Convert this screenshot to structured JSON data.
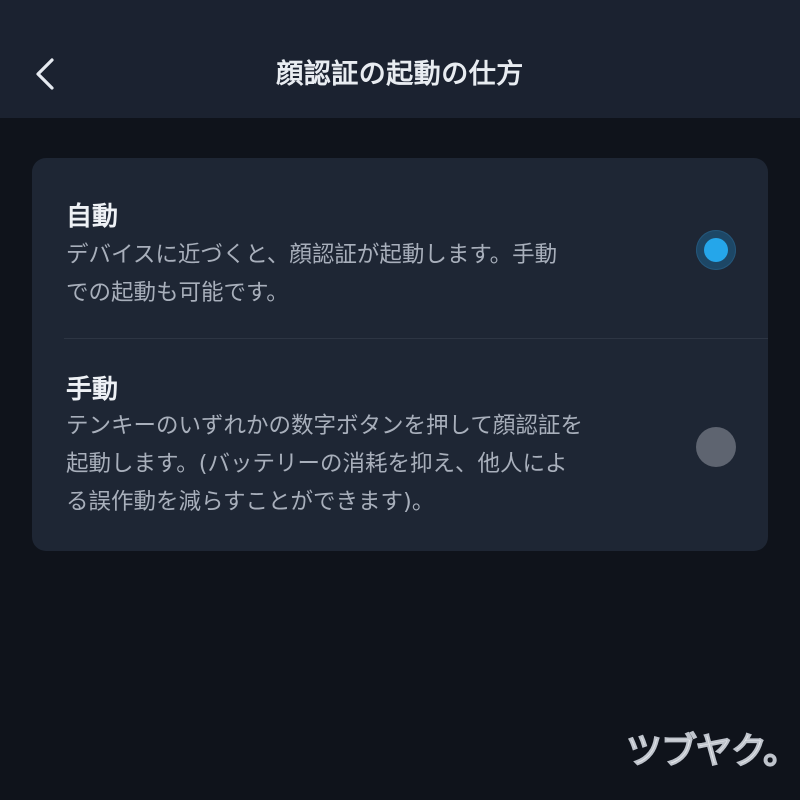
{
  "header": {
    "title": "顔認証の起動の仕方",
    "back_icon": "chevron-left-icon"
  },
  "options": [
    {
      "title": "自動",
      "description_lines": [
        "デバイスに近づくと、顔認証が起動します。手動",
        "での起動も可能です。"
      ],
      "selected": true
    },
    {
      "title": "手動",
      "description_lines": [
        "テンキーのいずれかの数字ボタンを押して顔認証を",
        "起動します。(バッテリーの消耗を抑え、他人によ",
        "る誤作動を減らすことができます)。"
      ],
      "selected": false
    }
  ],
  "watermark": "ツブヤク。",
  "colors": {
    "background": "#0f131b",
    "header": "#1b2230",
    "card": "#1e2634",
    "accent": "#25a6ea",
    "radio_off": "#5e6470",
    "text_primary": "#eef1f5",
    "text_secondary": "#a8afbb"
  }
}
